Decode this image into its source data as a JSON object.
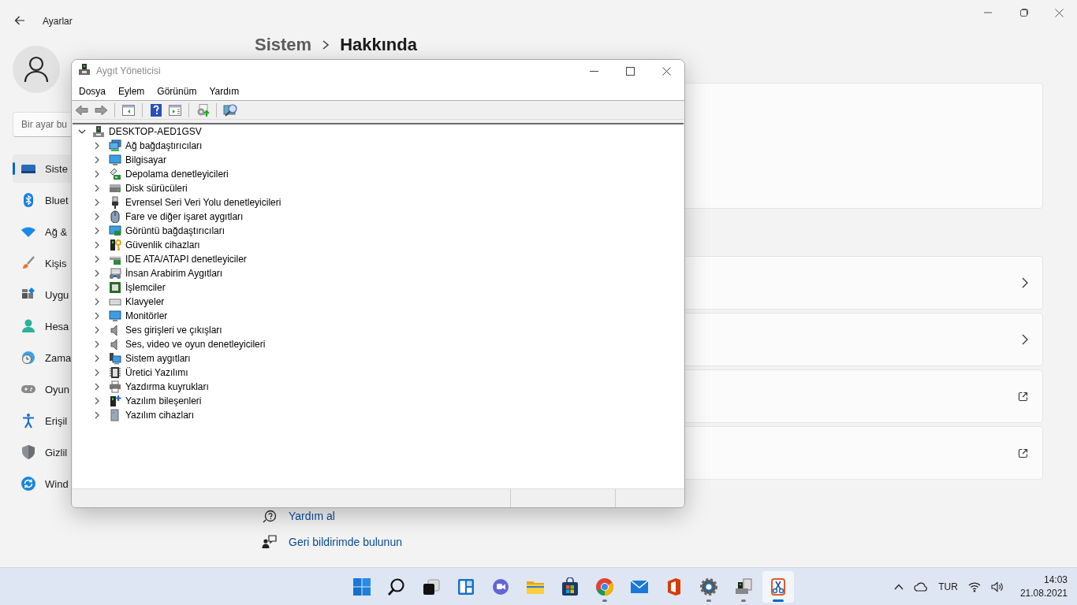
{
  "settings": {
    "title": "Ayarlar",
    "search": {
      "placeholder": "Bir ayar bu"
    },
    "nav": [
      {
        "kind": "system",
        "label": "Siste",
        "selected": true
      },
      {
        "kind": "bluetooth",
        "label": "Bluet",
        "selected": false
      },
      {
        "kind": "network",
        "label": "Ağ &",
        "selected": false
      },
      {
        "kind": "personalization",
        "label": "Kişis",
        "selected": false
      },
      {
        "kind": "apps",
        "label": "Uygu",
        "selected": false
      },
      {
        "kind": "accounts",
        "label": "Hesa",
        "selected": false
      },
      {
        "kind": "time",
        "label": "Zama",
        "selected": false
      },
      {
        "kind": "gaming",
        "label": "Oyun",
        "selected": false
      },
      {
        "kind": "accessibility",
        "label": "Erişil",
        "selected": false
      },
      {
        "kind": "privacy",
        "label": "Gizlil",
        "selected": false
      },
      {
        "kind": "update",
        "label": "Wind",
        "selected": false
      }
    ],
    "breadcrumb": [
      "Sistem",
      "Hakkında"
    ],
    "cards": [
      {
        "kind": "panel"
      },
      {
        "kind": "chevron"
      },
      {
        "kind": "chevron"
      },
      {
        "kind": "external"
      },
      {
        "kind": "external"
      }
    ],
    "help_links": [
      {
        "kind": "help",
        "label": "Yardım al"
      },
      {
        "kind": "feedback",
        "label": "Geri bildirimde bulunun"
      }
    ]
  },
  "device_manager": {
    "title": "Aygıt Yöneticisi",
    "menu": [
      "Dosya",
      "Eylem",
      "Görünüm",
      "Yardım"
    ],
    "toolbar": [
      {
        "kind": "back"
      },
      {
        "kind": "forward"
      },
      {
        "kind": "separator"
      },
      {
        "kind": "console-tree"
      },
      {
        "kind": "separator"
      },
      {
        "kind": "help"
      },
      {
        "kind": "action-pane"
      },
      {
        "kind": "separator"
      },
      {
        "kind": "update-driver"
      },
      {
        "kind": "separator"
      },
      {
        "kind": "scan"
      }
    ],
    "tree": {
      "label": "DESKTOP-AED1GSV",
      "kind": "computer-root",
      "expanded": true,
      "children": [
        {
          "label": "Ağ bağdaştırıcıları",
          "kind": "network",
          "expanded": false
        },
        {
          "label": "Bilgisayar",
          "kind": "monitor",
          "expanded": false
        },
        {
          "label": "Depolama denetleyicileri",
          "kind": "storage",
          "expanded": false
        },
        {
          "label": "Disk sürücüleri",
          "kind": "disk",
          "expanded": false
        },
        {
          "label": "Evrensel Seri Veri Yolu denetleyicileri",
          "kind": "usb",
          "expanded": false
        },
        {
          "label": "Fare ve diğer işaret aygıtları",
          "kind": "mouse",
          "expanded": false
        },
        {
          "label": "Görüntü bağdaştırıcıları",
          "kind": "display",
          "expanded": false
        },
        {
          "label": "Güvenlik cihazları",
          "kind": "security",
          "expanded": false
        },
        {
          "label": "IDE ATA/ATAPI denetleyiciler",
          "kind": "ide",
          "expanded": false
        },
        {
          "label": "İnsan Arabirim Aygıtları",
          "kind": "hid",
          "expanded": false
        },
        {
          "label": "İşlemciler",
          "kind": "cpu",
          "expanded": false
        },
        {
          "label": "Klavyeler",
          "kind": "keyboard",
          "expanded": false
        },
        {
          "label": "Monitörler",
          "kind": "monitor",
          "expanded": false
        },
        {
          "label": "Ses girişleri ve çıkışları",
          "kind": "audio",
          "expanded": false
        },
        {
          "label": "Ses, video ve oyun denetleyicileri",
          "kind": "audio",
          "expanded": false
        },
        {
          "label": "Sistem aygıtları",
          "kind": "system",
          "expanded": false
        },
        {
          "label": "Üretici Yazılımı",
          "kind": "firmware",
          "expanded": false
        },
        {
          "label": "Yazdırma kuyrukları",
          "kind": "printer",
          "expanded": false
        },
        {
          "label": "Yazılım bileşenleri",
          "kind": "component",
          "expanded": false
        },
        {
          "label": "Yazılım cihazları",
          "kind": "softdevice",
          "expanded": false
        }
      ]
    }
  },
  "taskbar": {
    "apps": [
      {
        "kind": "start",
        "running": false,
        "selected": false
      },
      {
        "kind": "search",
        "running": false,
        "selected": false
      },
      {
        "kind": "taskview",
        "running": false,
        "selected": false
      },
      {
        "kind": "widgets",
        "running": false,
        "selected": false
      },
      {
        "kind": "chat",
        "running": false,
        "selected": false
      },
      {
        "kind": "explorer",
        "running": false,
        "selected": false
      },
      {
        "kind": "store",
        "running": false,
        "selected": false
      },
      {
        "kind": "chrome",
        "running": true,
        "selected": false
      },
      {
        "kind": "mail",
        "running": false,
        "selected": false
      },
      {
        "kind": "office",
        "running": false,
        "selected": false
      },
      {
        "kind": "settings",
        "running": true,
        "selected": false
      },
      {
        "kind": "devmgr",
        "running": true,
        "selected": false
      },
      {
        "kind": "snip",
        "running": true,
        "selected": true
      }
    ],
    "language": "TUR",
    "time": "14:03",
    "date": "21.08.2021"
  }
}
